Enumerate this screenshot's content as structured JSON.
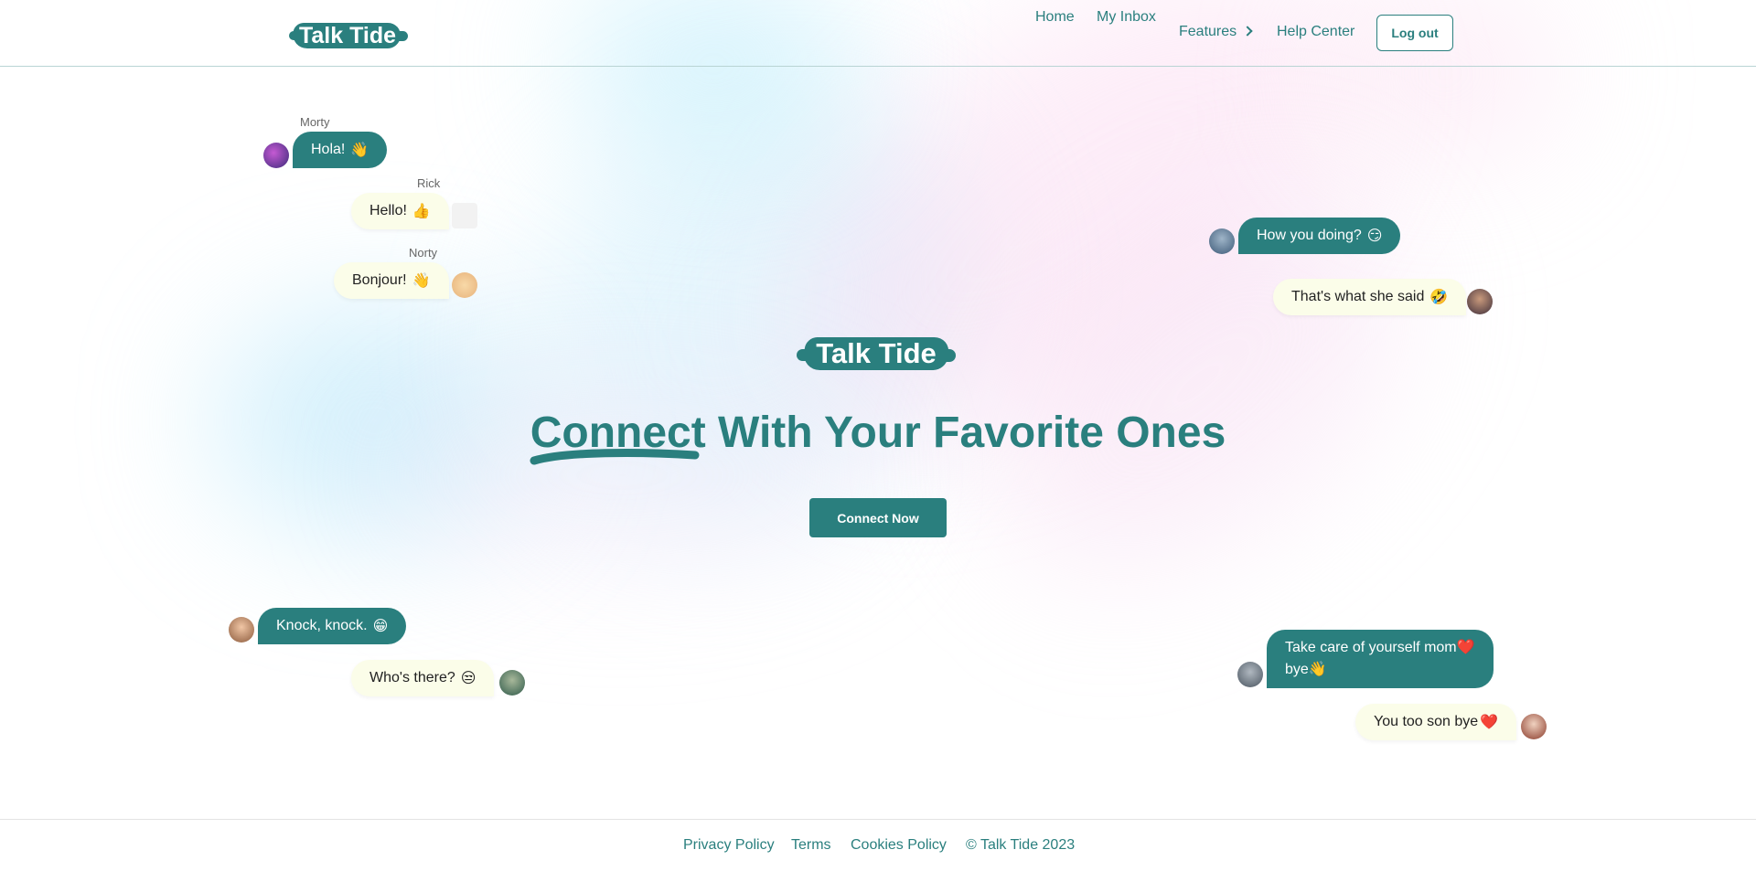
{
  "header": {
    "logo": "Talk Tide",
    "nav": {
      "home": "Home",
      "inbox": "My Inbox",
      "features": "Features",
      "help": "Help Center",
      "logout": "Log out"
    }
  },
  "chats": {
    "morty": {
      "name": "Morty",
      "text": "Hola!",
      "emoji": "👋"
    },
    "rick": {
      "name": "Rick",
      "text": "Hello!",
      "emoji": "👍"
    },
    "norty": {
      "name": "Norty",
      "text": "Bonjour!",
      "emoji": "👋"
    },
    "how": {
      "text": "How you doing?",
      "emoji": "😏"
    },
    "that": {
      "text": "That's what she said",
      "emoji": "🤣"
    },
    "knock": {
      "text": "Knock, knock.",
      "emoji": "😁"
    },
    "who": {
      "text": "Who's there?",
      "emoji": "😒"
    },
    "mom": {
      "text": "Take care of yourself mom",
      "emoji1": "❤️",
      "text2": "bye",
      "emoji2": "👋"
    },
    "son": {
      "text": "You too son bye",
      "emoji": "❤️"
    }
  },
  "hero": {
    "logo": "Talk Tide",
    "headline_highlight": "Connect",
    "headline_rest": " With Your Favorite Ones",
    "cta": "Connect Now"
  },
  "footer": {
    "privacy": "Privacy Policy",
    "terms": "Terms",
    "cookies": "Cookies Policy",
    "copyright": "© Talk Tide 2023"
  },
  "colors": {
    "brand": "#2a7f7e",
    "bubble_in": "#fbfde9"
  },
  "icons": {
    "features_chevron": "chevron-right-icon"
  }
}
